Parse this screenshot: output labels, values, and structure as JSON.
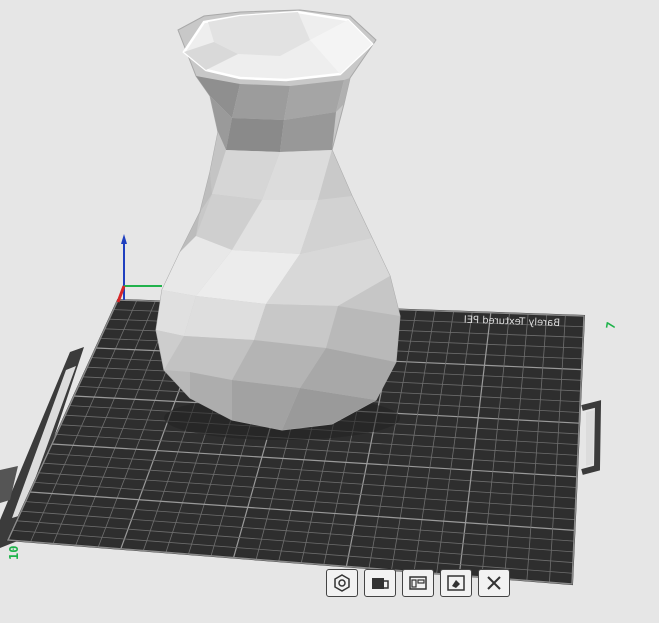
{
  "plate": {
    "label": "Barely Textured PEI"
  },
  "axes": {
    "x_color": "#d62728",
    "y_color": "#22b24c",
    "z_color": "#1f3fbf",
    "edge_numbers": {
      "right": "7",
      "left": "10"
    }
  },
  "model": {
    "icon": "vase-model",
    "color": "#cfcfcf"
  },
  "toolbar": {
    "buttons": [
      {
        "icon": "hexagon-icon"
      },
      {
        "icon": "camera-icon"
      },
      {
        "icon": "arrange-icon"
      },
      {
        "icon": "paint-bucket-icon"
      },
      {
        "icon": "close-icon"
      }
    ]
  }
}
